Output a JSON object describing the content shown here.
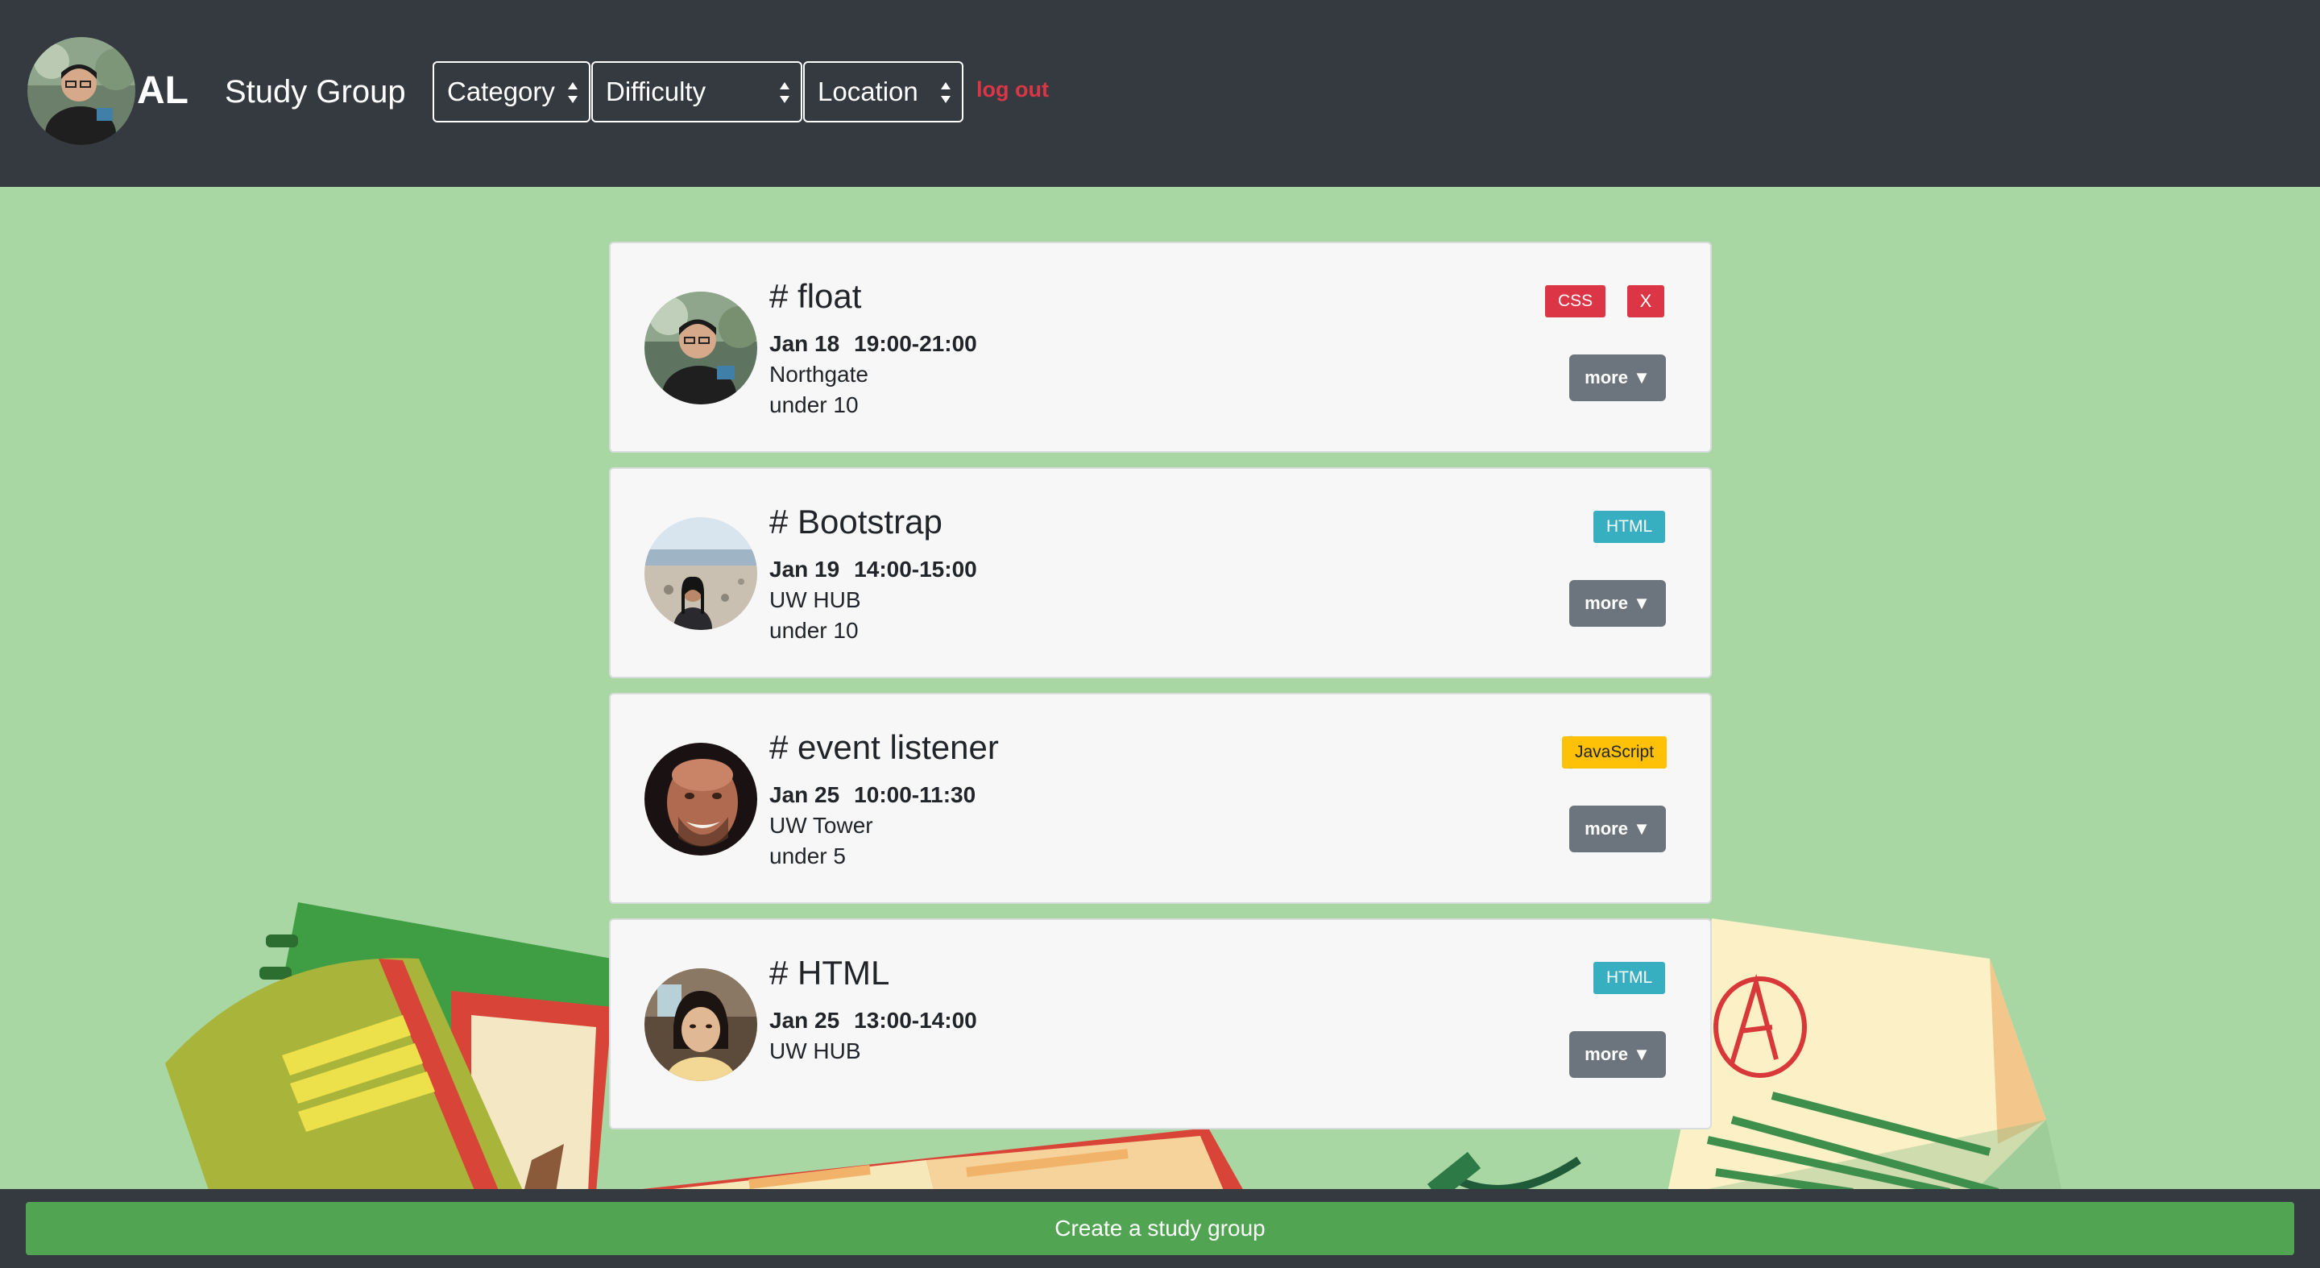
{
  "header": {
    "user_initials": "AL",
    "brand": "Study Group",
    "filters": [
      {
        "label": "Category"
      },
      {
        "label": "Difficulty"
      },
      {
        "label": "Location"
      }
    ],
    "logout_label": "log out"
  },
  "groups": [
    {
      "title": "# float",
      "date": "Jan 18",
      "time": "19:00-21:00",
      "location": "Northgate",
      "size": "under 10",
      "tag": "CSS",
      "delete_label": "X",
      "more_label": "more ▼"
    },
    {
      "title": "# Bootstrap",
      "date": "Jan 19",
      "time": "14:00-15:00",
      "location": "UW HUB",
      "size": "under 10",
      "tag": "HTML",
      "more_label": "more ▼"
    },
    {
      "title": "# event listener",
      "date": "Jan 25",
      "time": "10:00-11:30",
      "location": "UW Tower",
      "size": "under 5",
      "tag": "JavaScript",
      "more_label": "more ▼"
    },
    {
      "title": "# HTML",
      "date": "Jan 25",
      "time": "13:00-14:00",
      "location": "UW HUB",
      "tag": "HTML",
      "more_label": "more ▼"
    }
  ],
  "footer": {
    "create_label": "Create a study group"
  },
  "colors": {
    "navbar": "#343a40",
    "background": "#a9d7a4",
    "create_button": "#51a552",
    "danger": "#dc3545",
    "info": "#17a2b8",
    "warning": "#ffc107",
    "secondary": "#6c757d"
  }
}
